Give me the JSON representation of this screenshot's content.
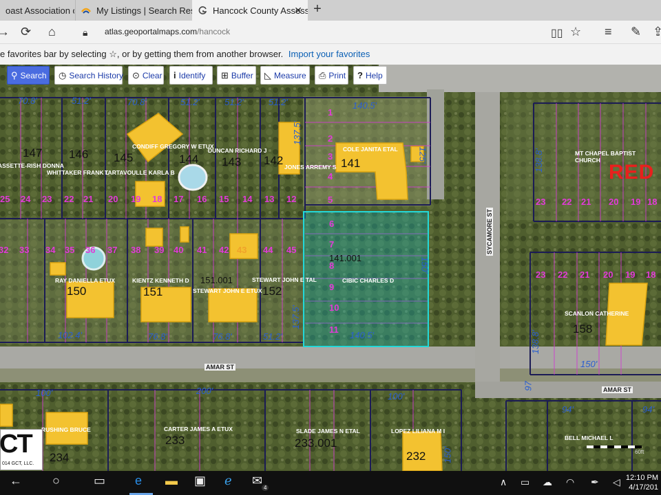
{
  "browser": {
    "tabs": [
      {
        "title": "oast Association of Re"
      },
      {
        "title": "My Listings | Search Results"
      },
      {
        "title": "Hancock County Assess"
      }
    ],
    "url_host": "atlas.geoportalmaps.com",
    "url_path": "/hancock",
    "favorites_message": "e favorites bar by selecting ☆, or by getting them from another browser.",
    "import_link": "Import your favorites"
  },
  "toolbar": {
    "search": "Search",
    "search_history": "Search History",
    "clear": "Clear",
    "identify": "Identify",
    "buffer": "Buffer",
    "measure": "Measure",
    "print": "Print",
    "help": "Help"
  },
  "map": {
    "streets": [
      "AMAR ST",
      "AMAR ST",
      "SYCAMORE ST"
    ],
    "owners": [
      "ASSETTE-RISH DONNA",
      "WHITTAKER FRANK L",
      "TARTAVOULLE KARLA B",
      "CONDIFF GREGORY W ETUX",
      "DUNCAN RICHARD J",
      "JONES ARREMY S",
      "COLE JANITA ETAL",
      "MT CHAPEL BAPTIST CHURCH",
      "RAY DANIELLA ETUX",
      "KIENTZ KENNETH D",
      "STEWART JOHN E ETUX",
      "STEWART JOHN E TAL",
      "CIBIC CHARLES D",
      "SCANLON CATHERINE",
      "RUSHING BRUCE",
      "CARTER JAMES A ETUX",
      "SLADE JAMES N ETAL",
      "LOPEZ LILIANA M I",
      "BELL MICHAEL L"
    ],
    "parcels": [
      "147",
      "146",
      "145",
      "144",
      "143",
      "142",
      "141",
      "150",
      "151",
      "151.001",
      "152",
      "141.001",
      "158",
      "233",
      "233.001",
      "232",
      "234"
    ],
    "lots_row1": [
      "25",
      "24",
      "23",
      "22",
      "21",
      "20",
      "19",
      "18",
      "17",
      "16",
      "15",
      "14",
      "13",
      "12"
    ],
    "lots_row2": [
      "32",
      "33",
      "34",
      "35",
      "36",
      "37",
      "38",
      "39",
      "40",
      "41",
      "42",
      "43",
      "44",
      "45"
    ],
    "lots_141": [
      "1",
      "2",
      "3",
      "4",
      "5"
    ],
    "lots_141001": [
      "6",
      "7",
      "8",
      "9",
      "10",
      "11"
    ],
    "lots_church": [
      "23",
      "22",
      "21",
      "20",
      "19",
      "18"
    ],
    "lots_158": [
      "23",
      "22",
      "21",
      "20",
      "19",
      "18"
    ],
    "dimensions_top": [
      "70.8'",
      "51.2'",
      "70.8'",
      "51.2'",
      "51.2'",
      "51.2'",
      "140.5'"
    ],
    "dimensions_bottom": [
      "102.4'",
      "76.8'",
      "76.8'",
      "51.2'",
      "140.5'",
      "150'"
    ],
    "dimensions_misc": [
      "137.5'",
      "137.5'",
      "125'",
      "150'",
      "138.8'",
      "138.8'",
      "100'",
      "200'",
      "100'",
      "94'",
      "94'",
      "150'",
      "97"
    ],
    "red_label": "RED",
    "logo_text": "CT",
    "logo_sub": "014 GCT, LLC.",
    "scale_label": "60ft"
  },
  "taskbar": {
    "time": "12:10 PM",
    "date": "4/17/201",
    "mail_badge": "4"
  }
}
